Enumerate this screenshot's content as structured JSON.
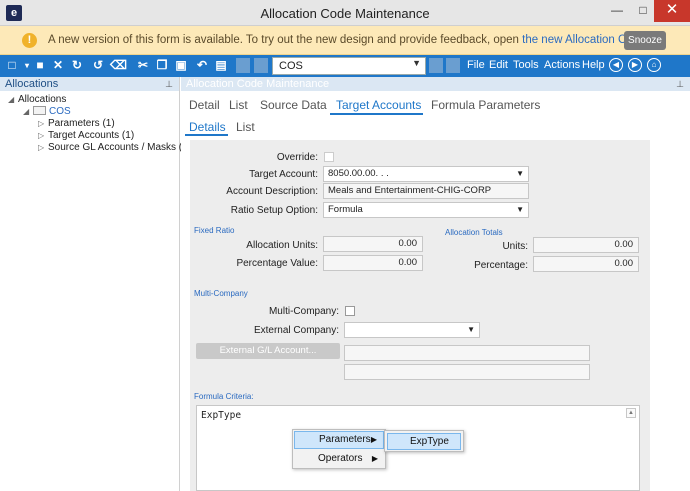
{
  "window": {
    "app_icon": "e",
    "title": "Allocation Code Maintenance",
    "minimize": "—",
    "maximize": "□",
    "close": "✕"
  },
  "banner": {
    "text": "A new version of this form is available. To try out the new design and provide feedback, open ",
    "link": "the new Allocation Code",
    "button": "Snooze",
    "icon": "warning-icon",
    "bg_color": "#fde9b8"
  },
  "toolbar": {
    "accent_color": "#1f77c9",
    "icons": [
      "new-icon",
      "save-icon",
      "delete-icon",
      "refresh-icon",
      "undo-icon",
      "clear-icon",
      "cut-icon",
      "copy-icon",
      "paste-icon",
      "attachment-icon",
      "undo-arrow-icon",
      "print-icon"
    ],
    "record_combo_value": "COS",
    "menus": [
      "File",
      "Edit",
      "Tools",
      "Actions",
      "Help"
    ]
  },
  "sidebar": {
    "header": "Allocations",
    "tree": {
      "root": "Allocations",
      "code": "COS",
      "children": [
        "Parameters (1)",
        "Target Accounts (1)",
        "Source GL Accounts / Masks (1)"
      ]
    }
  },
  "main": {
    "header": "Allocation Code Maintenance",
    "tabs": [
      "Detail",
      "List",
      "Source Data",
      "Target Accounts",
      "Formula Parameters"
    ],
    "active_tab": "Target Accounts",
    "subtabs": [
      "Details",
      "List"
    ],
    "active_subtab": "Details"
  },
  "form": {
    "override_label": "Override:",
    "target_account_label": "Target Account:",
    "target_account_value": "8050.00.00.        .          .",
    "account_description_label": "Account Description:",
    "account_description_value": "Meals and Entertainment-CHIG-CORP",
    "ratio_setup_label": "Ratio Setup Option:",
    "ratio_setup_value": "Formula",
    "fixed_ratio_section": "Fixed Ratio",
    "allocation_units_label": "Allocation Units:",
    "allocation_units_value": "0.00",
    "percentage_value_label": "Percentage Value:",
    "percentage_value_value": "0.00",
    "allocation_totals_section": "Allocation Totals",
    "units_label": "Units:",
    "units_value": "0.00",
    "percentage_label": "Percentage:",
    "percentage_value": "0.00",
    "multi_company_section": "Multi-Company",
    "multi_company_label": "Multi-Company:",
    "external_company_label": "External Company:",
    "external_company_value": "",
    "external_gl_button": "External G/L Account...",
    "formula_criteria_section": "Formula Criteria:",
    "formula_text": "ExpType"
  },
  "context_menu": {
    "items": [
      "Parameters",
      "Operators"
    ],
    "highlighted": "Parameters",
    "submenu_items": [
      "ExpType"
    ]
  }
}
